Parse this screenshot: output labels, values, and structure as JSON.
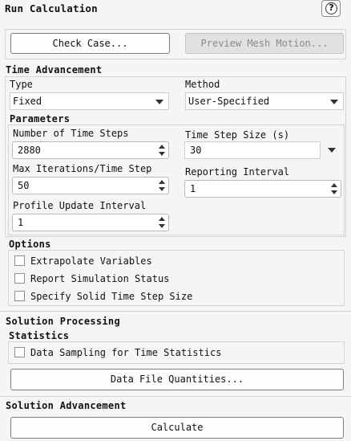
{
  "header": {
    "title": "Run Calculation",
    "help_glyph": "?"
  },
  "top_buttons": {
    "check_case": "Check Case...",
    "preview_mesh_motion": "Preview Mesh Motion..."
  },
  "time_advancement": {
    "title": "Time Advancement",
    "type_label": "Type",
    "type_value": "Fixed",
    "method_label": "Method",
    "method_value": "User-Specified"
  },
  "parameters": {
    "title": "Parameters",
    "num_time_steps_label": "Number of Time Steps",
    "num_time_steps_value": "2880",
    "time_step_size_label": "Time Step Size (s)",
    "time_step_size_value": "30",
    "max_iterations_label": "Max Iterations/Time Step",
    "max_iterations_value": "50",
    "reporting_interval_label": "Reporting Interval",
    "reporting_interval_value": "1",
    "profile_update_label": "Profile Update Interval",
    "profile_update_value": "1"
  },
  "options": {
    "title": "Options",
    "items": [
      "Extrapolate Variables",
      "Report Simulation Status",
      "Specify Solid Time Step Size"
    ]
  },
  "solution_processing": {
    "title": "Solution Processing",
    "statistics_title": "Statistics",
    "data_sampling_label": "Data Sampling for Time Statistics",
    "data_file_quantities_button": "Data File Quantities..."
  },
  "solution_advancement": {
    "title": "Solution Advancement",
    "calculate_button": "Calculate"
  }
}
